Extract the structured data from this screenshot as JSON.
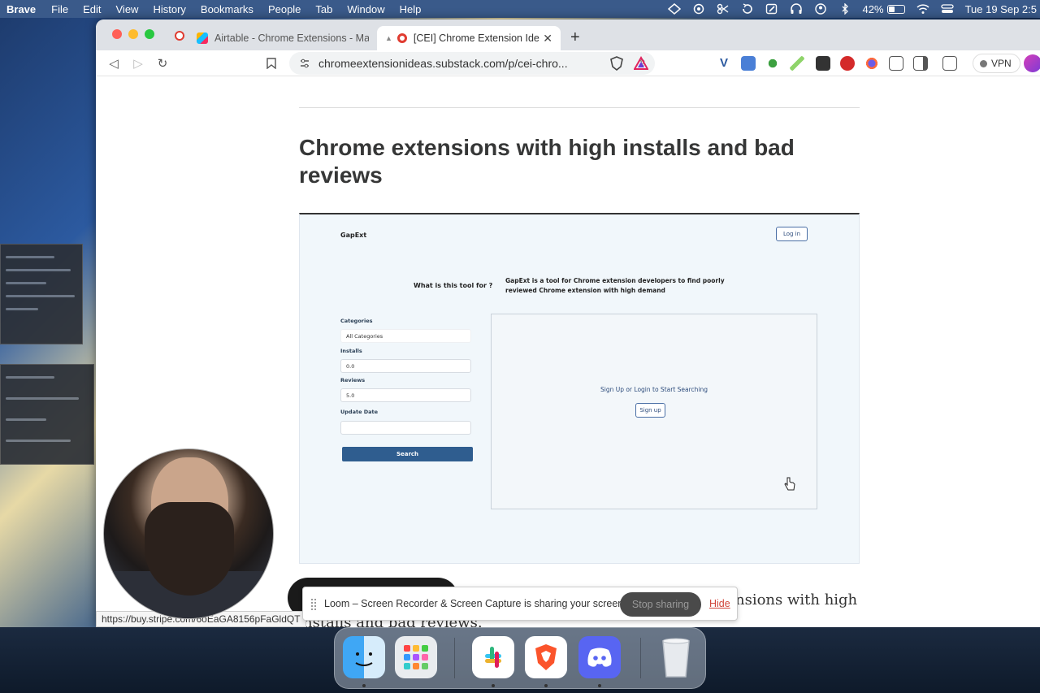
{
  "menubar": {
    "app": "Brave",
    "items": [
      "File",
      "Edit",
      "View",
      "History",
      "Bookmarks",
      "People",
      "Tab",
      "Window",
      "Help"
    ],
    "battery_percent": "42%",
    "battery_level": 0.42,
    "clock": "Tue 19 Sep 2:5"
  },
  "browser": {
    "tabs": [
      {
        "label": "Airtable - Chrome Extensions - May",
        "active": false
      },
      {
        "label": "[CEI] Chrome Extension Ide",
        "active": true
      }
    ],
    "url": "chromeextensionideas.substack.com/p/cei-chro...",
    "vpn_label": "VPN",
    "status_url": "https://buy.stripe.com/6oEaGA8156pFaGldQT"
  },
  "article": {
    "heading": "Chrome extensions with high installs and bad reviews",
    "body_text": "nsions with high",
    "body_text_line2": "nstalls and bad reviews."
  },
  "gapext": {
    "brand": "GapExt",
    "login_label": "Log in",
    "question": "What is this tool for ?",
    "answer": "GapExt is a tool for Chrome extension developers to find poorly reviewed Chrome extension with high demand",
    "fields": {
      "categories_label": "Categories",
      "categories_value": "All Categories",
      "installs_label": "Installs",
      "installs_value": "0.0",
      "reviews_label": "Reviews",
      "reviews_value": "5.0",
      "update_label": "Update Date",
      "update_value": ""
    },
    "search_label": "Search",
    "result_message": "Sign Up or Login to Start Searching",
    "signup_label": "Sign up"
  },
  "loom": {
    "message": "Loom – Screen Recorder & Screen Capture is sharing your screen.",
    "stop_label": "Stop sharing",
    "hide_label": "Hide"
  },
  "dock": {
    "apps": [
      "finder-icon",
      "launchpad-icon",
      "slack-icon",
      "brave-icon",
      "discord-icon",
      "trash-icon"
    ]
  },
  "colors": {
    "accent": "#2f5d8f",
    "heading": "#363737",
    "hide_link": "#d0453a"
  }
}
